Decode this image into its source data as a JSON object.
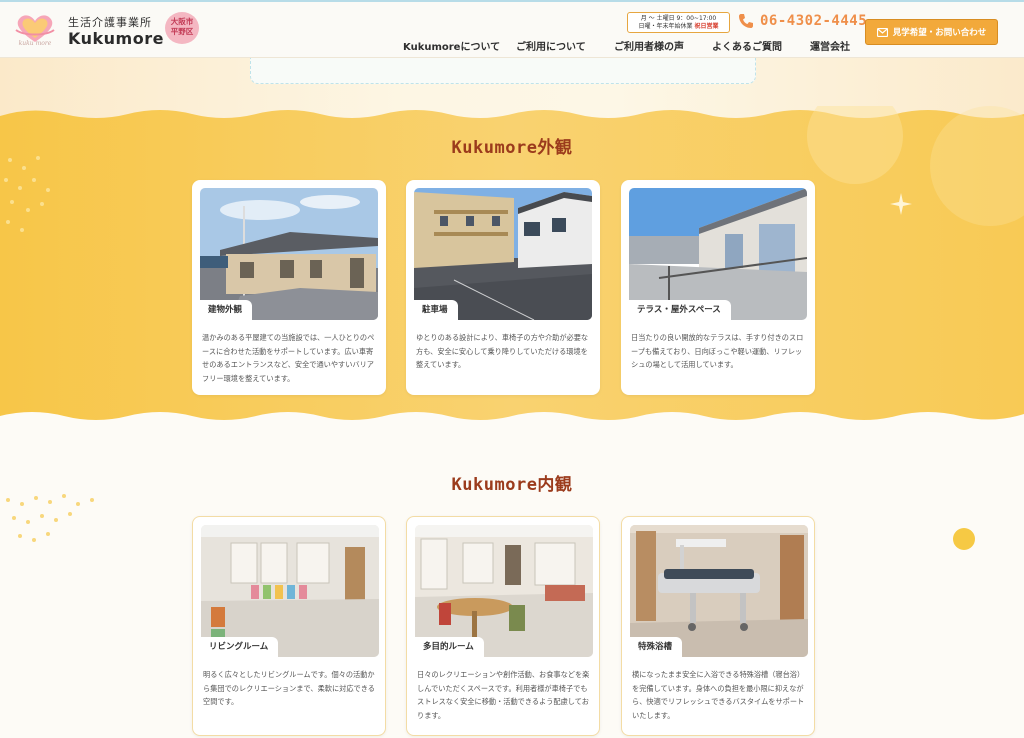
{
  "header": {
    "brand_top": "生活介護事業所",
    "brand_name": "Kukumore",
    "logo_sub": "kuku more",
    "area_badge_line1": "大阪市",
    "area_badge_line2": "平野区",
    "hours_line1": "月 ～ 土曜日 9：00~17:00",
    "hours_line2": "日曜・年末年始休業",
    "hours_holiday": "祝日営業",
    "phone": "06-4302-4445",
    "contact_label": "見学希望・お問い合わせ"
  },
  "nav": [
    {
      "label": "Kukumoreについて"
    },
    {
      "label": "ご利用について"
    },
    {
      "label": "ご利用者様の声"
    },
    {
      "label": "よくあるご質問"
    },
    {
      "label": "運営会社"
    }
  ],
  "exterior": {
    "title": "Kukumore外観",
    "cards": [
      {
        "tag": "建物外観",
        "text": "温かみのある平屋建ての当施設では、一人ひとりのペースに合わせた活動をサポートしています。広い車寄せのあるエントランスなど、安全で通いやすいバリアフリー環境を整えています。"
      },
      {
        "tag": "駐車場",
        "text": "ゆとりのある設計により、車椅子の方や介助が必要な方も、安全に安心して乗り降りしていただける環境を整えています。"
      },
      {
        "tag": "テラス・屋外スペース",
        "text": "日当たりの良い開放的なテラスは、手すり付きのスロープも備えており、日向ぼっこや軽い運動、リフレッシュの場として活用しています。"
      }
    ]
  },
  "interior": {
    "title": "Kukumore内観",
    "cards": [
      {
        "tag": "リビングルーム",
        "text": "明るく広々としたリビングルームです。個々の活動から集団でのレクリエーションまで、柔軟に対応できる空間です。"
      },
      {
        "tag": "多目的ルーム",
        "text": "日々のレクリエーションや創作活動、お食事などを楽しんでいただくスペースです。利用者様が車椅子でもストレスなく安全に移動・活動できるよう配慮しております。"
      },
      {
        "tag": "特殊浴槽",
        "text": "横になったまま安全に入浴できる特殊浴槽（寝台浴）を完備しています。身体への負担を最小限に抑えながら、快適でリフレッシュできるバスタイムをサポートいたします。"
      }
    ]
  },
  "colors": {
    "accent_yellow": "#f8cf5c",
    "title_brown": "#9b3b1c",
    "button_orange": "#f2a93b",
    "phone_orange": "#ef8f4a"
  }
}
